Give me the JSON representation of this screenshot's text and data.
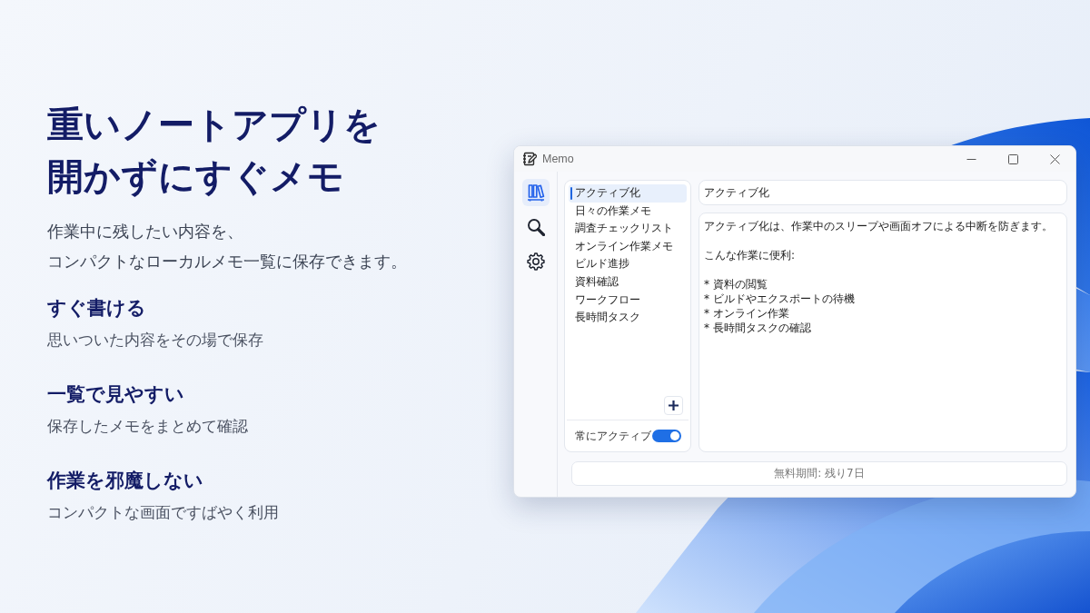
{
  "hero": {
    "headline": "重いノートアプリを開かずにすぐメモ",
    "subtitle_lines": [
      "作業中に残したい内容を、",
      "コンパクトなローカルメモ一覧に保存できます。"
    ]
  },
  "features": [
    {
      "title": "すぐ書ける",
      "description": "思いついた内容をその場で保存"
    },
    {
      "title": "一覧で見やすい",
      "description": "保存したメモをまとめて確認"
    },
    {
      "title": "作業を邪魔しない",
      "description": "コンパクトな画面ですばやく利用"
    }
  ],
  "app_window": {
    "title": "Memo",
    "nav": [
      {
        "kind": "library",
        "selected": true
      },
      {
        "kind": "search",
        "selected": false
      },
      {
        "kind": "settings",
        "selected": false
      }
    ],
    "memo_list": [
      {
        "label": "アクティブ化",
        "selected": true
      },
      {
        "label": "日々の作業メモ",
        "selected": false
      },
      {
        "label": "調査チェックリスト",
        "selected": false
      },
      {
        "label": "オンライン作業メモ",
        "selected": false
      },
      {
        "label": "ビルド進捗",
        "selected": false
      },
      {
        "label": "資料確認",
        "selected": false
      },
      {
        "label": "ワークフロー",
        "selected": false
      },
      {
        "label": "長時間タスク",
        "selected": false
      }
    ],
    "always_active": {
      "label": "常にアクティブ",
      "on": true
    },
    "editor": {
      "title": "アクティブ化",
      "body_paragraphs": [
        [
          "アクティブ化は、作業中のスリープや画面オフによる中断を防ぎます。"
        ],
        [
          "こんな作業に便利:"
        ],
        [
          "* 資料の閲覧",
          "* ビルドやエクスポートの待機",
          "* オンライン作業",
          "* 長時間タスクの確認"
        ]
      ]
    },
    "status_bar": "無料期間: 残り7日"
  }
}
